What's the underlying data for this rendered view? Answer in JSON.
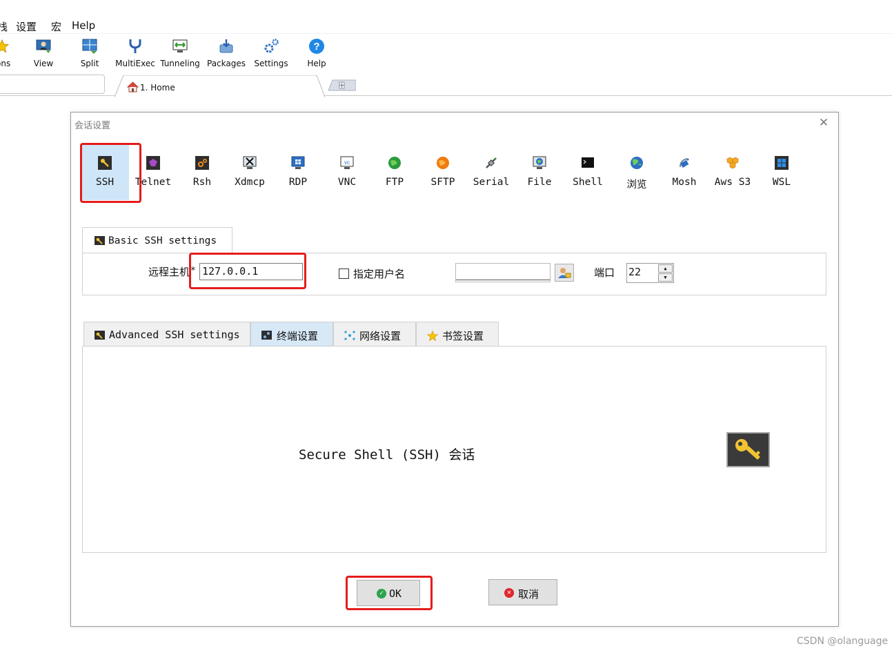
{
  "menubar": {
    "items": [
      "栈",
      "设置",
      "宏",
      "Help"
    ]
  },
  "toolbar": {
    "items": [
      {
        "label": "ions",
        "icon": "sessions-star-icon"
      },
      {
        "label": "View",
        "icon": "view-icon"
      },
      {
        "label": "Split",
        "icon": "split-icon"
      },
      {
        "label": "MultiExec",
        "icon": "multiexec-icon"
      },
      {
        "label": "Tunneling",
        "icon": "tunneling-icon"
      },
      {
        "label": "Packages",
        "icon": "packages-icon"
      },
      {
        "label": "Settings",
        "icon": "settings-icon"
      },
      {
        "label": "Help",
        "icon": "help-icon"
      }
    ]
  },
  "tabs": {
    "home_label": "1. Home"
  },
  "dialog": {
    "title": "会话设置",
    "protocols": [
      {
        "label": "SSH",
        "icon": "ssh-key-icon",
        "selected": true
      },
      {
        "label": "Telnet",
        "icon": "telnet-icon"
      },
      {
        "label": "Rsh",
        "icon": "rsh-icon"
      },
      {
        "label": "Xdmcp",
        "icon": "xdmcp-icon"
      },
      {
        "label": "RDP",
        "icon": "rdp-icon"
      },
      {
        "label": "VNC",
        "icon": "vnc-icon"
      },
      {
        "label": "FTP",
        "icon": "ftp-icon"
      },
      {
        "label": "SFTP",
        "icon": "sftp-icon"
      },
      {
        "label": "Serial",
        "icon": "serial-icon"
      },
      {
        "label": "File",
        "icon": "file-icon"
      },
      {
        "label": "Shell",
        "icon": "shell-icon"
      },
      {
        "label": "浏览",
        "icon": "browser-globe-icon"
      },
      {
        "label": "Mosh",
        "icon": "mosh-icon"
      },
      {
        "label": "Aws S3",
        "icon": "aws-s3-icon"
      },
      {
        "label": "WSL",
        "icon": "wsl-icon"
      }
    ],
    "basic": {
      "tab_label": "Basic SSH settings",
      "remote_host_label": "远程主机",
      "required_mark": "*",
      "remote_host_value": "127.0.0.1",
      "specify_user_label": "指定用户名",
      "specify_user_checked": false,
      "username_value": "",
      "port_label": "端口",
      "port_value": "22"
    },
    "advanced_tabs": [
      {
        "label": "Advanced SSH settings",
        "icon": "ssh-key-icon",
        "active": true
      },
      {
        "label": "终端设置",
        "icon": "terminal-icon"
      },
      {
        "label": "网络设置",
        "icon": "network-icon"
      },
      {
        "label": "书签设置",
        "icon": "bookmark-star-icon"
      }
    ],
    "description": "Secure Shell (SSH) 会话",
    "buttons": {
      "ok": "OK",
      "cancel": "取消"
    }
  },
  "watermark": "CSDN @olanguage",
  "colors": {
    "highlight_red": "#e51b1b",
    "selected_bg": "#cfe6f8"
  }
}
